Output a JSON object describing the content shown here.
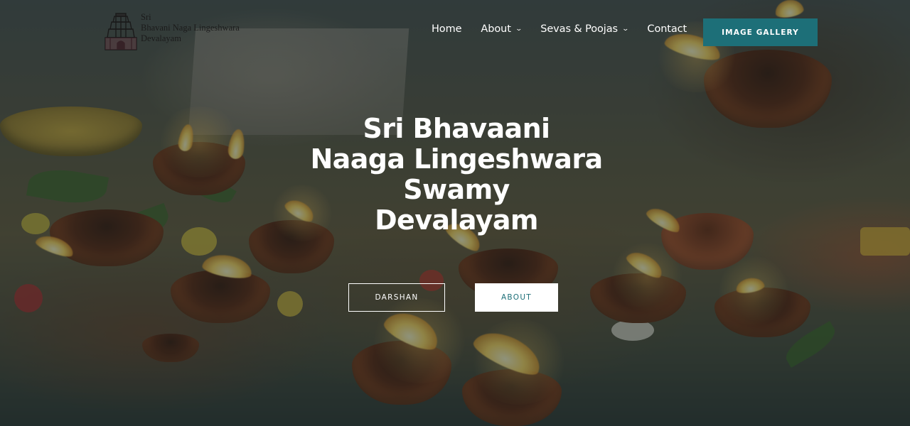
{
  "logo": {
    "lines": [
      "Sri",
      "Bhavani Naga Lingeshwara",
      "Devalayam"
    ],
    "icon": "temple-gopuram-icon"
  },
  "nav": {
    "items": [
      {
        "label": "Home",
        "dropdown": false,
        "active": true
      },
      {
        "label": "About",
        "dropdown": true,
        "icon": "chevron-down-icon"
      },
      {
        "label": "Sevas & Poojas",
        "dropdown": true,
        "icon": "chevron-down-icon"
      },
      {
        "label": "Contact",
        "dropdown": false
      }
    ],
    "cta_label": "IMAGE GALLERY"
  },
  "hero": {
    "title_lines": [
      "Sri Bhavaani",
      "Naaga Lingeshwara",
      "Swamy",
      "Devalayam"
    ],
    "buttons": {
      "darshan": "DARSHAN",
      "about": "ABOUT"
    }
  },
  "colors": {
    "accent": "#1d6f78",
    "text_on_dark": "#ffffff",
    "overlay": "rgba(20,38,40,0.48)"
  }
}
